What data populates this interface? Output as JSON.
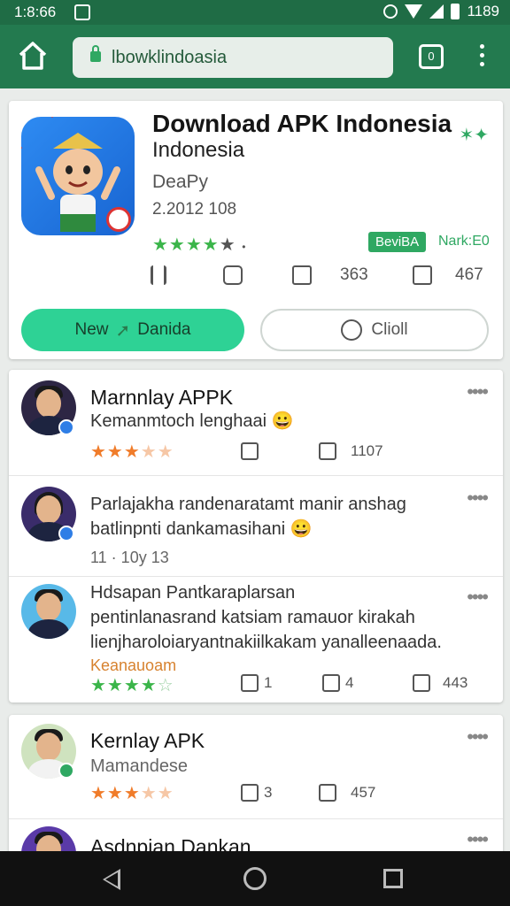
{
  "status_bar": {
    "time": "1:8:66",
    "battery_text": "1189"
  },
  "toolbar": {
    "url": "lbowklindoasia",
    "tabs_count": "0"
  },
  "app": {
    "title": "Download APK Indonesia",
    "subtitle": "Indonesia",
    "developer": "DeaPy",
    "meta": "2.2012 108",
    "rating_stars": 4,
    "tag": "BeviBA",
    "tag_extra": "Nark:E0",
    "action_count_1": "363",
    "action_count_2": "467",
    "primary_button": "New",
    "primary_button_extra": "Danida",
    "secondary_button": "Clioll"
  },
  "reviews": [
    {
      "name": "Marnnlay APPK",
      "text_lines": [
        "Kemanmtoch lenghaai 😀"
      ],
      "stars": 3,
      "count_2": "1107"
    },
    {
      "name": "",
      "text_lines": [
        "Parlajakha randenaratamt manir anshag",
        "batlinpnti dankamasihani 😀"
      ],
      "meta": "11 · 10y 13"
    },
    {
      "name": "",
      "text_lines": [
        "Hdsapan Pantkaraplarsan",
        "pentinlanasrand katsiam ramauor kirakah",
        "lienjharoloiaryantnakiilkakam yanalleenaada."
      ],
      "highlight": "Keanauoam",
      "stars": 4,
      "count_1": "1",
      "count_2": "4",
      "count_3": "443"
    },
    {
      "name": "Kernlay APK",
      "text_lines": [
        "Mamandese"
      ],
      "stars": 3,
      "count_1": "3",
      "count_2": "457"
    },
    {
      "name": "Asdnpian Dankan",
      "text_lines": []
    }
  ],
  "colors": {
    "toolbar": "#237a4f",
    "status_bar": "#1f6c45",
    "primary_button": "#2ed295",
    "accent_green": "#2fa862",
    "star_orange": "#f07c2a"
  },
  "icons": {
    "home": "home-icon",
    "lock": "lock-icon",
    "tabs": "tabs-icon",
    "menu": "more-vert-icon",
    "share": "share-icon",
    "comment": "comment-icon",
    "bookmark": "bookmark-icon"
  }
}
